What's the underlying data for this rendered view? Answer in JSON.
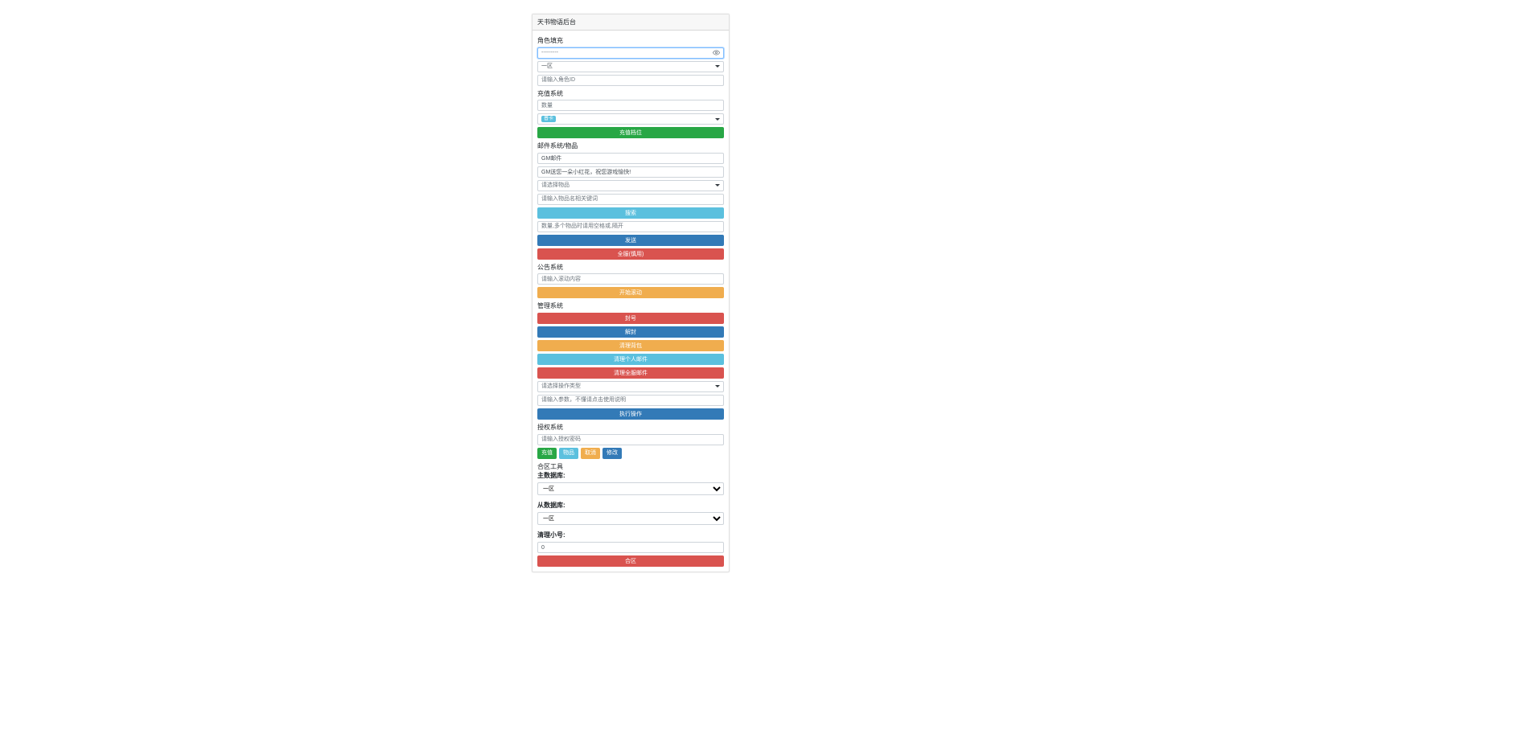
{
  "header": {
    "title": "天书物语后台"
  },
  "roleFill": {
    "label": "角色填充",
    "serverPlaceholder": "---------",
    "zoneSelected": "一区",
    "roleIdPlaceholder": "请输入角色ID"
  },
  "recharge": {
    "label": "充值系统",
    "amountPlaceholder": "数量",
    "tierBadge": "普卡",
    "button": "充值档位"
  },
  "mail": {
    "label": "邮件系统/物品",
    "titleValue": "GM邮件",
    "contentValue": "GM送您一朵小红花，祝您游戏愉快!",
    "itemSelectPlaceholder": "请选择物品",
    "searchPlaceholder": "请输入物品名相关键词",
    "searchButton": "搜索",
    "qtyPlaceholder": "数量,多个物品时请用空格或,隔开",
    "sendButton": "发送",
    "sendAllButton": "全服(慎用)"
  },
  "announce": {
    "label": "公告系统",
    "contentPlaceholder": "请输入滚动内容",
    "startButton": "开始滚动"
  },
  "manage": {
    "label": "管理系统",
    "banButton": "封号",
    "unbanButton": "解封",
    "clearBagButton": "清理背包",
    "clearPersonalMailButton": "清理个人邮件",
    "clearAllMailButton": "清理全服邮件",
    "opSelectPlaceholder": "请选择操作类型",
    "paramPlaceholder": "请输入参数，不懂请点击使用说明",
    "execButton": "执行操作"
  },
  "auth": {
    "label": "授权系统",
    "codePlaceholder": "请输入授权密码",
    "btnRecharge": "充值",
    "btnItem": "物品",
    "btnCancel": "取消",
    "btnModify": "修改"
  },
  "merge": {
    "toolLabel": "合区工具",
    "mainDbLabel": "主数据库:",
    "subDbLabel": "从数据库:",
    "dbOption": "一区",
    "cleanAltLabel": "清理小号:",
    "cleanAltValue": "0",
    "mergeButton": "合区"
  }
}
